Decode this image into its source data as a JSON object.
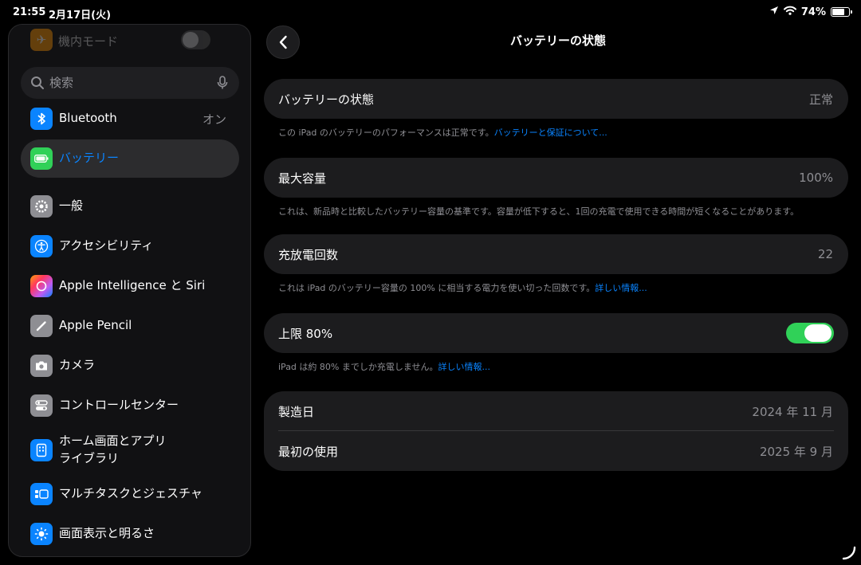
{
  "status_bar": {
    "time": "21:55",
    "date": "2月17日(火)",
    "battery_percent": "74%",
    "battery_level": 0.74
  },
  "sidebar": {
    "airplane_label": "機内モード",
    "search": {
      "placeholder": "検索"
    },
    "items": [
      {
        "label": "Bluetooth",
        "value": "オン",
        "icon": "bluetooth-icon",
        "color": "#0a84ff"
      },
      {
        "label": "バッテリー",
        "icon": "battery-icon",
        "color": "#30d158",
        "selected": true
      },
      {
        "label": "一般",
        "icon": "gear-icon",
        "color": "#8e8e93"
      },
      {
        "label": "アクセシビリティ",
        "icon": "accessibility-icon",
        "color": "#0a84ff"
      },
      {
        "label": "Apple Intelligence と Siri",
        "icon": "siri-icon",
        "color": "#bf5af2"
      },
      {
        "label": "Apple Pencil",
        "icon": "pencil-icon",
        "color": "#8e8e93"
      },
      {
        "label": "カメラ",
        "icon": "camera-icon",
        "color": "#8e8e93"
      },
      {
        "label": "コントロールセンター",
        "icon": "control-center-icon",
        "color": "#8e8e93"
      },
      {
        "label_line1": "ホーム画面とアプリ",
        "label_line2": "ライブラリ",
        "icon": "home-screen-icon",
        "color": "#0a84ff"
      },
      {
        "label": "マルチタスクとジェスチャ",
        "icon": "multitasking-icon",
        "color": "#0a84ff"
      },
      {
        "label": "画面表示と明るさ",
        "icon": "brightness-icon",
        "color": "#0a84ff"
      }
    ]
  },
  "detail": {
    "title": "バッテリーの状態",
    "health": {
      "label": "バッテリーの状態",
      "value": "正常",
      "note": "この iPad のバッテリーのパフォーマンスは正常です。",
      "link": "バッテリーと保証について..."
    },
    "capacity": {
      "label": "最大容量",
      "value": "100%",
      "note": "これは、新品時と比較したバッテリー容量の基準です。容量が低下すると、1回の充電で使用できる時間が短くなることがあります。"
    },
    "cycles": {
      "label": "充放電回数",
      "value": "22",
      "note": "これは iPad のバッテリー容量の 100% に相当する電力を使い切った回数です。",
      "link": "詳しい情報..."
    },
    "limit": {
      "label": "上限 80%",
      "enabled": true,
      "note": "iPad は約 80% までしか充電しません。",
      "link": "詳しい情報..."
    },
    "manufacture": {
      "label": "製造日",
      "value": "2024 年 11 月"
    },
    "first_use": {
      "label": "最初の使用",
      "value": "2025 年 9 月"
    }
  }
}
